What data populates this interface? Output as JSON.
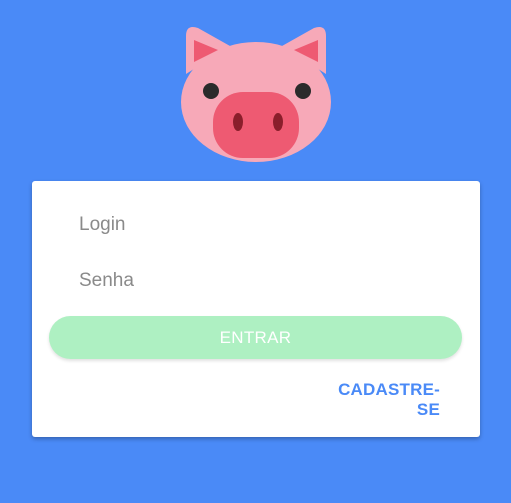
{
  "colors": {
    "background": "#4a8af7",
    "card": "#ffffff",
    "button_disabled": "#aef0c2",
    "link": "#4a8af7",
    "pig_face": "#f7a9b8",
    "pig_snout": "#ee5a72"
  },
  "logo": {
    "icon": "pig-face-icon"
  },
  "form": {
    "login_placeholder": "Login",
    "login_value": "",
    "password_placeholder": "Senha",
    "password_value": "",
    "submit_label": "ENTRAR",
    "register_label": "CADASTRE-SE"
  }
}
